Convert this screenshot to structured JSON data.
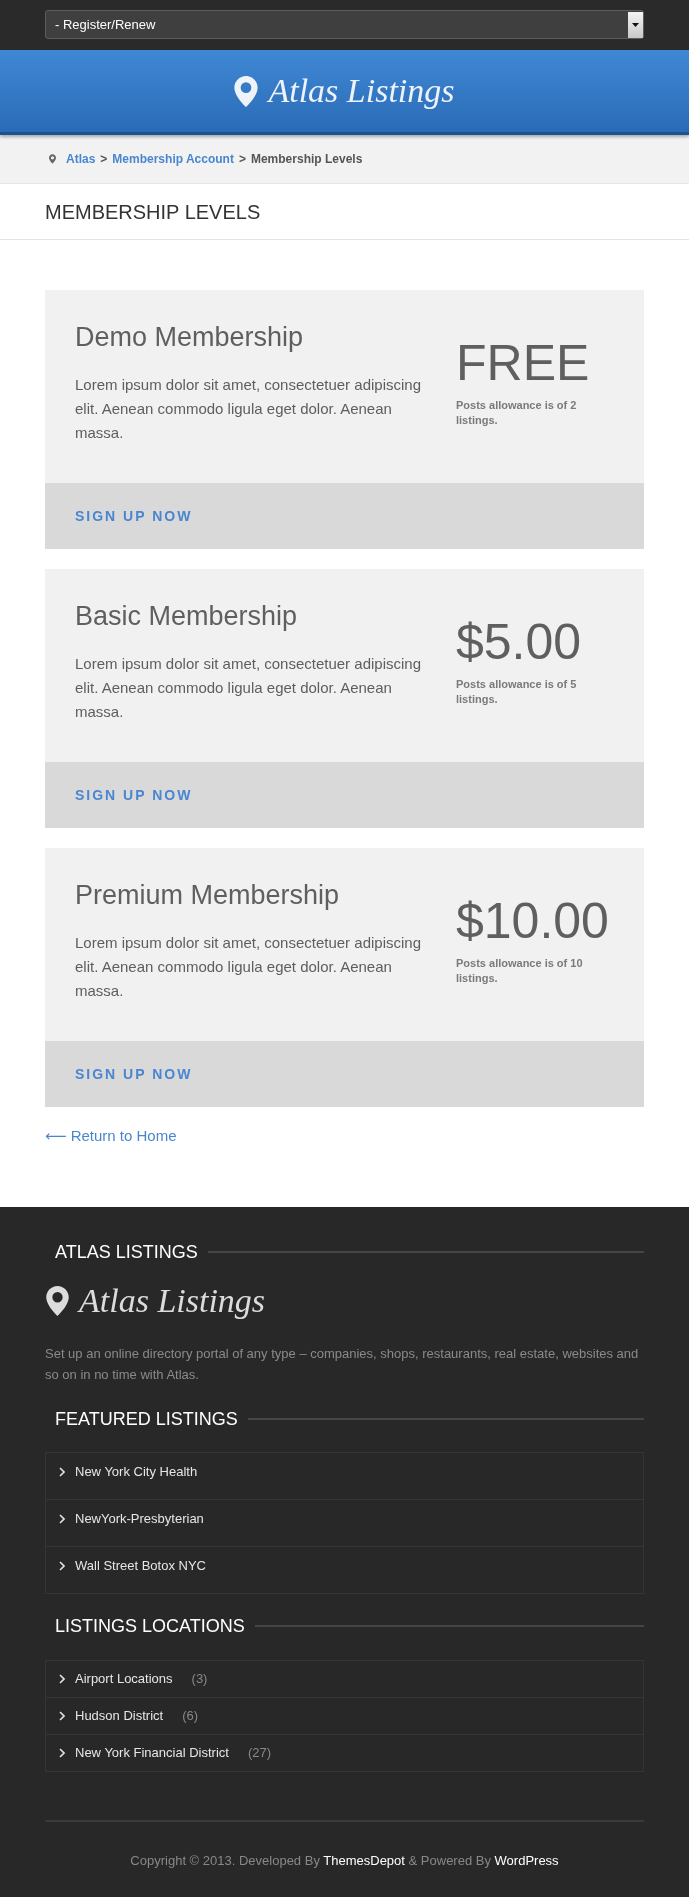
{
  "top_bar": {
    "menu_select": {
      "value": "- Register/Renew"
    }
  },
  "header": {
    "logo_text": "Atlas Listings"
  },
  "breadcrumb": {
    "items": [
      {
        "kind": "link",
        "text": "Atlas"
      },
      {
        "kind": "separator",
        "text": ">"
      },
      {
        "kind": "link",
        "text": "Membership Account"
      },
      {
        "kind": "separator",
        "text": ">"
      },
      {
        "kind": "current",
        "text": "Membership Levels"
      }
    ]
  },
  "page_title": "MEMBERSHIP LEVELS",
  "plans": [
    {
      "name": "Demo Membership",
      "description": "Lorem ipsum dolor sit amet, consectetuer adipiscing elit. Aenean commodo ligula eget dolor. Aenean massa.",
      "price": "FREE",
      "allowance": "Posts allowance is of 2 listings.",
      "button": "SIGN UP NOW"
    },
    {
      "name": "Basic Membership",
      "description": "Lorem ipsum dolor sit amet, consectetuer adipiscing elit. Aenean commodo ligula eget dolor. Aenean massa.",
      "price": "$5.00",
      "allowance": "Posts allowance is of 5 listings.",
      "button": "SIGN UP NOW"
    },
    {
      "name": "Premium Membership",
      "description": "Lorem ipsum dolor sit amet, consectetuer adipiscing elit. Aenean commodo ligula eget dolor. Aenean massa.",
      "price": "$10.00",
      "allowance": "Posts allowance is of 10 listings.",
      "button": "SIGN UP NOW"
    }
  ],
  "return_link": "⟵ Return to Home",
  "footer": {
    "about": {
      "heading": "ATLAS LISTINGS",
      "logo_text": "Atlas Listings",
      "text": "Set up an online directory portal of any type – companies, shops, restaurants, real estate, websites and so on in no time with Atlas."
    },
    "featured": {
      "heading": "FEATURED LISTINGS",
      "items": [
        "New York City Health",
        "NewYork-Presbyterian",
        "Wall Street Botox NYC"
      ]
    },
    "locations": {
      "heading": "LISTINGS LOCATIONS",
      "items": [
        {
          "name": "Airport Locations",
          "count": "(3)"
        },
        {
          "name": "Hudson District",
          "count": "(6)"
        },
        {
          "name": "New York Financial District",
          "count": "(27)"
        }
      ]
    },
    "copyright": [
      {
        "kind": "text",
        "text": "Copyright © 2013. Developed By"
      },
      {
        "kind": "link",
        "text": "ThemesDepot"
      },
      {
        "kind": "text",
        "text": "& Powered By"
      },
      {
        "kind": "link",
        "text": "WordPress"
      }
    ]
  }
}
